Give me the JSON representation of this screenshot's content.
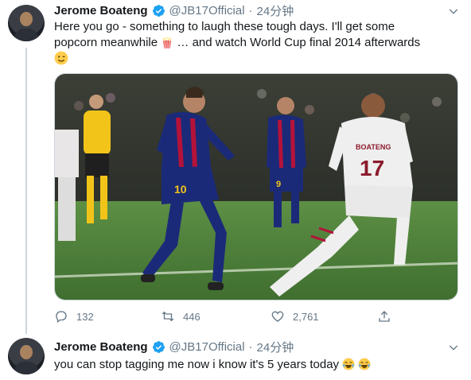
{
  "tweets": [
    {
      "author_name": "Jerome Boateng",
      "handle": "@JB17Official",
      "separator": "·",
      "time": "24分钟",
      "text_line1": "Here you go - something to laugh these tough days. I'll get some",
      "text_line2_a": "popcorn meanwhile",
      "text_line2_b": "… and watch World Cup final 2014 afterwards",
      "emoji_popcorn": "popcorn-emoji",
      "emoji_wink": "wink-emoji",
      "media": {
        "player_left_number": "10",
        "player_right_number": "17",
        "player_right_name": "BOATENG"
      },
      "actions": {
        "reply_count": "132",
        "retweet_count": "446",
        "like_count": "2,761"
      }
    },
    {
      "author_name": "Jerome Boateng",
      "handle": "@JB17Official",
      "separator": "·",
      "time": "24分钟",
      "text": "you can stop tagging me now i know it's 5 years today",
      "emoji_laugh": "tears-of-joy-emoji"
    }
  ],
  "colors": {
    "verified_blue": "#1da1f2",
    "secondary_text": "#657786",
    "pitch_green": "#4d7c39"
  }
}
